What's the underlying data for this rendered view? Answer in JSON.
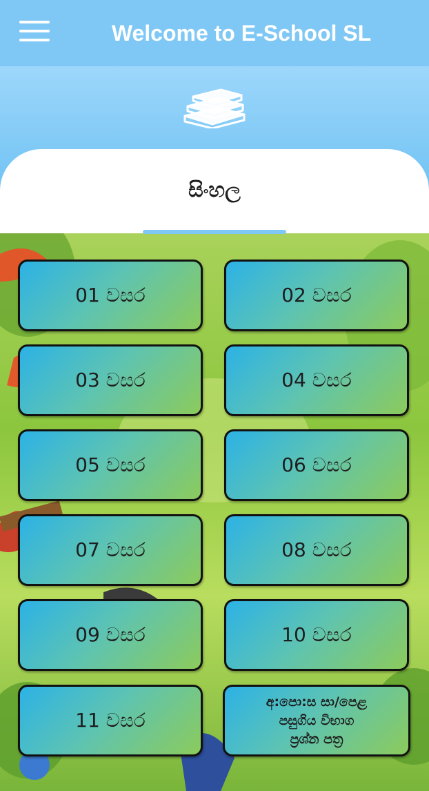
{
  "app_bar": {
    "title": "Welcome to E-School SL",
    "menu_icon": "hamburger-menu-icon"
  },
  "header": {
    "icon": "books-icon"
  },
  "panel": {
    "title": "සිංහල"
  },
  "grades": [
    {
      "label": "01 වසර"
    },
    {
      "label": "02 වසර"
    },
    {
      "label": "03 වසර"
    },
    {
      "label": "04 වසර"
    },
    {
      "label": "05 වසර"
    },
    {
      "label": "06 වසර"
    },
    {
      "label": "07 වසර"
    },
    {
      "label": "08 වසර"
    },
    {
      "label": "09 වසර"
    },
    {
      "label": "10 වසර"
    },
    {
      "label": "11 වසර"
    },
    {
      "label": "අ:පො:ස සා/පෙළ\nපසුගිය විභාග\nප්‍රශ්න පත්‍ර"
    }
  ],
  "colors": {
    "app_bar": "#7fc8f5",
    "header_gradient_top": "#9dd7fb",
    "header_gradient_bottom": "#6cc0f3",
    "button_gradient_start": "#2cb2e6",
    "button_gradient_end": "#8ccb5c",
    "tab_indicator": "#7fc8f5"
  }
}
